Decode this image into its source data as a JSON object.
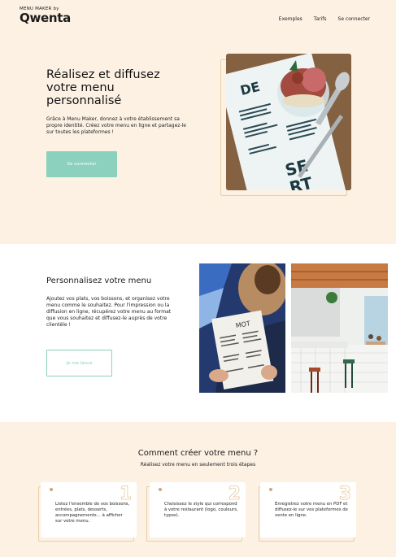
{
  "header": {
    "logo_small": "MENU MAKER by",
    "logo_big": "Qwenta",
    "nav": [
      "Exemples",
      "Tarifs",
      "Se connecter"
    ]
  },
  "hero": {
    "title": "Réalisez et diffusez votre menu personnalisé",
    "text": "Grâce à Menu Maker, donnez à votre établissement sa propre identité. Créez votre menu en ligne et partagez-le sur toutes les plateformes !",
    "button": "Se connecter"
  },
  "personalize": {
    "title": "Personnalisez votre menu",
    "text": "Ajoutez vos plats, vos boissons, et organisez votre menu comme le souhaitez. Pour l'impression ou la diffusion en ligne, récupérez votre menu au format que vous souhaitez et diffusez-le auprès de votre clientèle !",
    "button": "Je me lance"
  },
  "steps": {
    "title": "Comment créer votre menu ?",
    "subtitle": "Réalisez votre menu en seulement trois étapes",
    "items": [
      {
        "number": "1",
        "text": "Listez l'ensemble de vos boissons, entrées, plats, desserts, accompagnements… à afficher sur votre menu."
      },
      {
        "number": "2",
        "text": "Choisissez le style qui correspond à votre restaurant (logo, couleurs, typos)."
      },
      {
        "number": "3",
        "text": "Enregistrez votre menu en PDF et diffusez-le sur vos plateformes de vente en ligne."
      }
    ]
  },
  "photo_text": {
    "dessert_menu": "DESSERT"
  },
  "colors": {
    "accent": "#8bd1bd",
    "cream": "#fdf1e4",
    "gold": "#e6cfa8"
  }
}
